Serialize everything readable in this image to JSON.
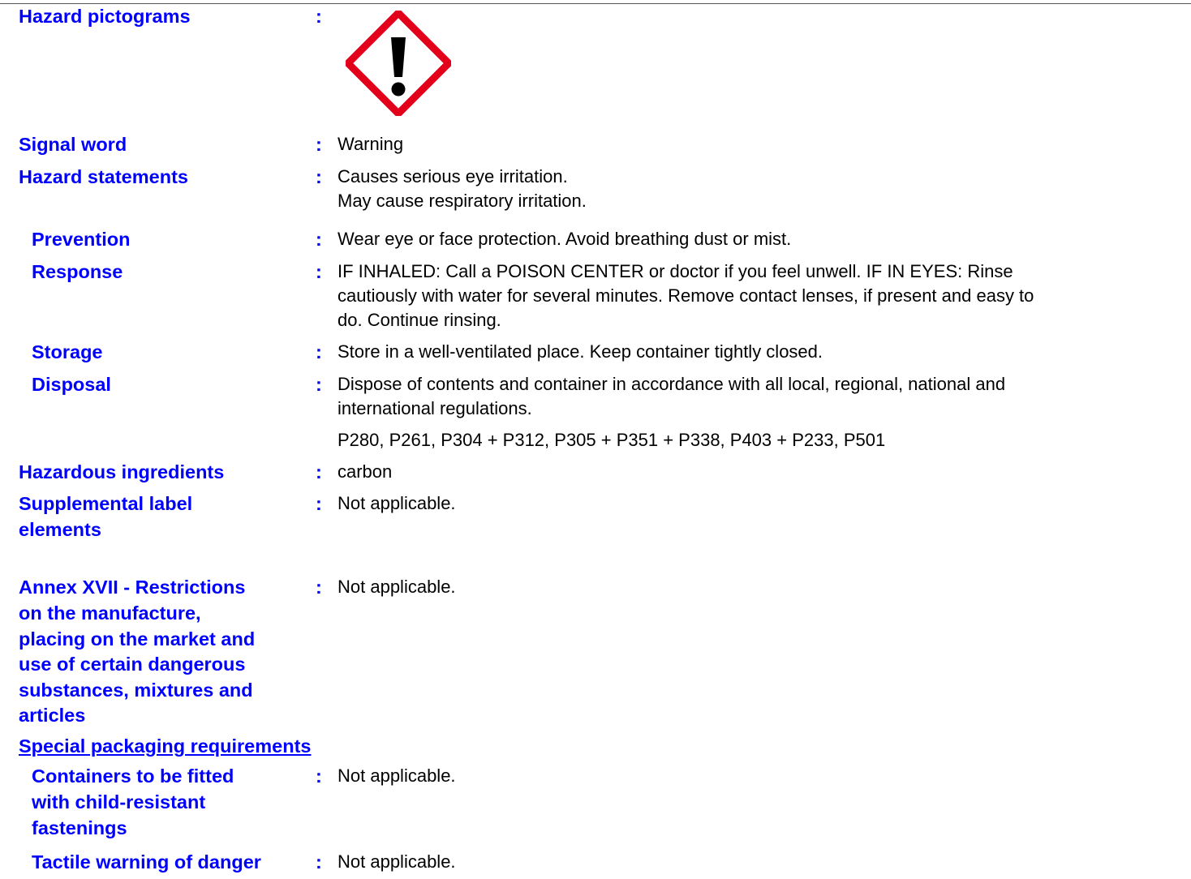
{
  "label_color": "#0000ff",
  "pictogram": {
    "icon": "exclamation-mark-ghs07-icon",
    "border_color": "#e2001a"
  },
  "separator": ":",
  "rows": {
    "hazard_pictograms": {
      "label": "Hazard pictograms"
    },
    "signal_word": {
      "label": "Signal word",
      "value": "Warning"
    },
    "hazard_statements": {
      "label": "Hazard statements",
      "lines": [
        "Causes serious eye irritation.",
        "May cause respiratory irritation."
      ]
    },
    "prevention": {
      "label": "Prevention",
      "value": "Wear eye or face protection.  Avoid breathing dust or mist."
    },
    "response": {
      "label": "Response",
      "lines": [
        "IF INHALED: Call a POISON CENTER or doctor if you feel unwell.  IF IN EYES: Rinse",
        "cautiously with water for several minutes. Remove contact lenses, if present and easy to",
        "do. Continue rinsing."
      ]
    },
    "storage": {
      "label": "Storage",
      "value": "Store in a well-ventilated place. Keep container tightly closed."
    },
    "disposal": {
      "label": "Disposal",
      "lines": [
        "Dispose of contents and container in accordance with all local, regional, national and",
        "international regulations."
      ]
    },
    "p_codes": "P280, P261, P304 + P312, P305 + P351 + P338, P403 + P233, P501",
    "hazardous_ingredients": {
      "label": "Hazardous ingredients",
      "value": "carbon"
    },
    "supplemental": {
      "label_lines": [
        "Supplemental label",
        "elements"
      ],
      "value": "Not applicable."
    },
    "annex": {
      "label_lines": [
        "Annex XVII - Restrictions",
        "on the manufacture,",
        "placing on the market and",
        "use of certain dangerous",
        "substances, mixtures and",
        "articles"
      ],
      "value": "Not applicable."
    },
    "special_packaging_heading": "Special packaging requirements",
    "child_resistant": {
      "label_lines": [
        "Containers to be fitted",
        "with child-resistant",
        "fastenings"
      ],
      "value": "Not applicable."
    },
    "tactile": {
      "label": "Tactile warning of danger",
      "value": "Not applicable."
    }
  }
}
